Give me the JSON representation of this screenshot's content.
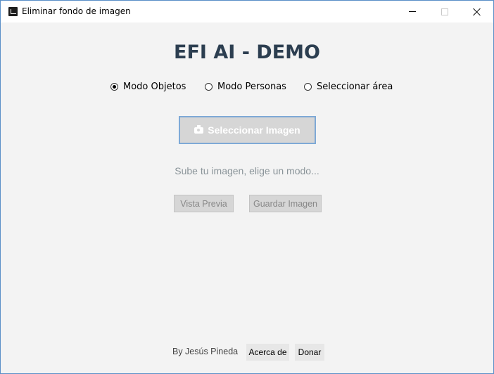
{
  "window": {
    "title": "Eliminar fondo de imagen",
    "icon": "app-shirt-icon"
  },
  "main": {
    "heading": "EFI AI - DEMO",
    "modes": [
      {
        "label": "Modo Objetos",
        "selected": true
      },
      {
        "label": "Modo Personas",
        "selected": false
      },
      {
        "label": "Seleccionar área",
        "selected": false
      }
    ],
    "select_button": "Seleccionar Imagen",
    "select_button_icon": "camera-icon",
    "status": "Sube tu imagen, elige un modo...",
    "preview_button": "Vista Previa",
    "save_button": "Guardar Imagen"
  },
  "footer": {
    "author": "By Jesús Pineda",
    "about_button": "Acerca de",
    "donate_button": "Donar"
  },
  "colors": {
    "heading": "#2c3e50",
    "window_bg": "#f3f3f3",
    "button_border": "#7ea9d6"
  }
}
